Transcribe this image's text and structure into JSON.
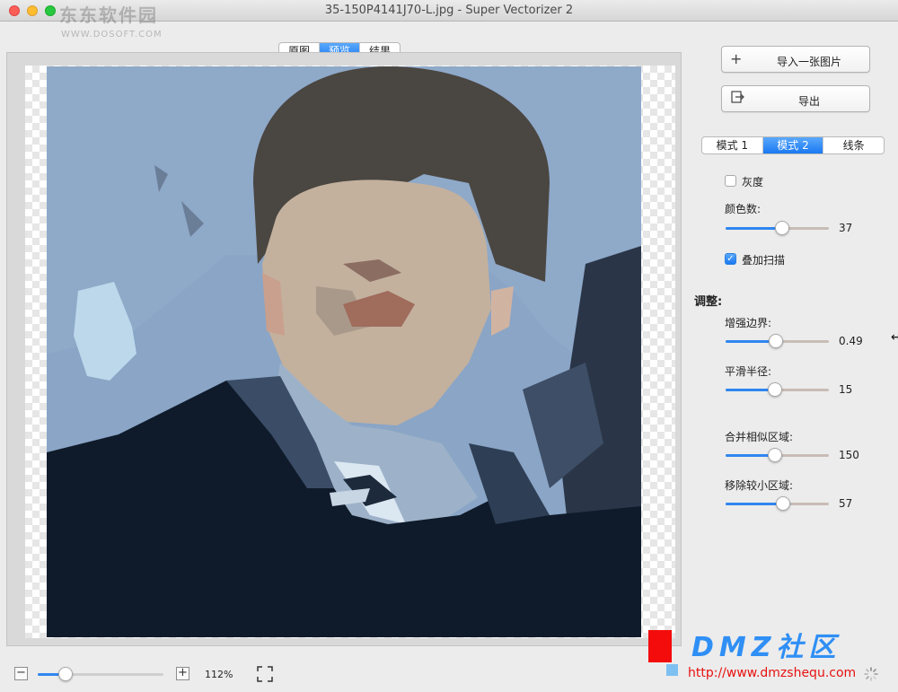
{
  "window": {
    "title": "35-150P4141J70-L.jpg - Super Vectorizer 2"
  },
  "watermark": {
    "logo_text": "东东软件园",
    "url": "WWW.DOSOFT.COM"
  },
  "view_tabs": [
    {
      "label": "原图",
      "active": false
    },
    {
      "label": "预览",
      "active": true
    },
    {
      "label": "结果",
      "active": false
    }
  ],
  "actions": {
    "import_label": "导入一张图片",
    "export_label": "导出"
  },
  "mode_tabs": [
    {
      "label": "模式 1",
      "active": false
    },
    {
      "label": "模式 2",
      "active": true
    },
    {
      "label": "线条",
      "active": false
    }
  ],
  "options": {
    "grayscale": {
      "label": "灰度",
      "checked": false
    },
    "color_count": {
      "label": "颜色数:",
      "value": "37",
      "level": 0.55
    },
    "overlay_scan": {
      "label": "叠加扫描",
      "checked": true
    }
  },
  "adjust": {
    "heading": "调整:",
    "sliders": [
      {
        "label": "增强边界:",
        "value": "0.49",
        "level": 0.49
      },
      {
        "label": "平滑半径:",
        "value": "15",
        "level": 0.48
      },
      {
        "label": "合并相似区域:",
        "value": "150",
        "level": 0.48
      },
      {
        "label": "移除较小区域:",
        "value": "57",
        "level": 0.56
      }
    ]
  },
  "zoom": {
    "value": "112%",
    "level": 0.22
  },
  "site_watermark": {
    "brand": "DMZ社区",
    "url": "http://www.dmzshequ.com"
  },
  "colors": {
    "accent": "#1978f2",
    "track": "#c9bcb6"
  }
}
